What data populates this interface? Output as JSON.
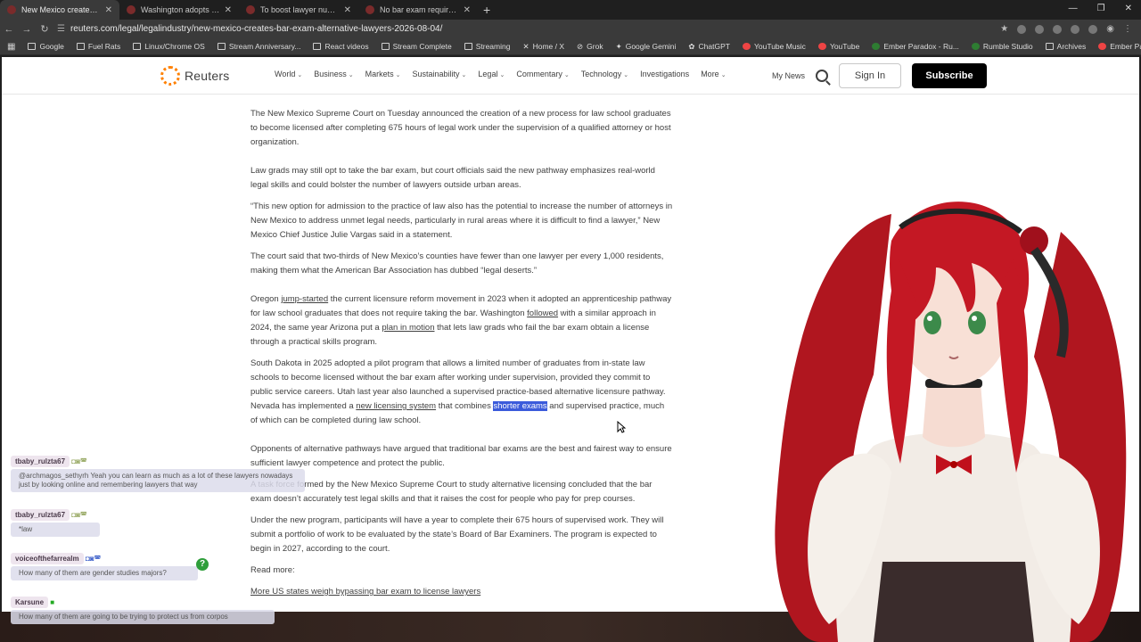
{
  "browser": {
    "tabs": [
      {
        "title": "New Mexico creates bar e",
        "active": true
      },
      {
        "title": "Washington adopts new lawye"
      },
      {
        "title": "To boost lawyer numbers in 'le"
      },
      {
        "title": "No bar exam required to prac"
      }
    ],
    "url": "reuters.com/legal/legalindustry/new-mexico-creates-bar-exam-alternative-lawyers-2026-08-04/",
    "bookmarks": [
      "Google",
      "Fuel Rats",
      "Linux/Chrome OS",
      "Stream Anniversary...",
      "React videos",
      "Stream Complete",
      "Streaming",
      "Home / X",
      "Grok",
      "Google Gemini",
      "ChatGPT",
      "YouTube Music",
      "YouTube",
      "Ember Paradox - Ru...",
      "Rumble Studio",
      "Archives",
      "Ember Paradox"
    ]
  },
  "site": {
    "logo_text": "Reuters",
    "nav": [
      "World",
      "Business",
      "Markets",
      "Sustainability",
      "Legal",
      "Commentary",
      "Technology",
      "Investigations",
      "More"
    ],
    "my_news": "My News",
    "sign_in": "Sign In",
    "subscribe": "Subscribe"
  },
  "article": {
    "p1": "The New Mexico Supreme Court on Tuesday announced the creation of a new process for law school graduates to become licensed after completing 675 hours of legal work under the supervision of a qualified attorney or host organization.",
    "p2": "Law grads may still opt to take the bar exam, but court officials said the new pathway emphasizes real-world legal skills and could bolster the number of lawyers outside urban areas.",
    "p3": "“This new option for admission to the practice of law also has the potential to increase the number of attorneys in New Mexico to address unmet legal needs, particularly in rural areas where it is difficult to find a lawyer,” New Mexico Chief Justice Julie Vargas said in a statement.",
    "p4": "The court said that two-thirds of New Mexico’s counties have fewer than one lawyer per every 1,000 residents, making them what the American Bar Association has dubbed “legal deserts.”",
    "p5": {
      "a": "Oregon ",
      "link1": "jump-started",
      "b": " the current licensure reform movement in 2023 when it adopted an apprenticeship pathway for law school graduates that does not require taking the bar. Washington ",
      "link2": "followed",
      "c": " with a similar approach in 2024, the same year Arizona put a ",
      "link3": "plan in motion",
      "d": " that lets law grads who fail the bar exam obtain a license through a practical skills program."
    },
    "p6": {
      "a": "South Dakota in 2025 adopted a pilot program that allows a limited number of graduates from in-state law schools to become licensed without the bar exam after working under supervision, provided they commit to public service careers. Utah last year also launched a supervised practice-based alternative licensure pathway. Nevada has implemented a ",
      "link1": "new licensing system",
      "b": " that combines ",
      "highlight": "shorter exams",
      "c": " and supervised practice, much of which can be completed during law school."
    },
    "p7": "Opponents of alternative pathways have argued that traditional bar exams are the best and fairest way to ensure sufficient lawyer competence and protect the public.",
    "p8": "A task force formed by the New Mexico Supreme Court to study alternative licensing concluded that the bar exam doesn’t accurately test legal skills and that it raises the cost for people who pay for prep courses.",
    "p9": "Under the new program, participants will have a year to complete their 675 hours of supervised work. They will submit a portfolio of work to be evaluated by the state’s Board of Bar Examiners. The program is expected to begin in 2027, according to the court.",
    "read_more": "Read more:",
    "read_more_link": "More US states weigh bypassing bar exam to license lawyers"
  },
  "chat": [
    {
      "user": "tbaby_rulzta67",
      "msg": "@archmagos_sethyrh Yeah you can learn as much as a lot of these lawyers nowadays just by looking online and remembering lawyers that way"
    },
    {
      "user": "tbaby_rulzta67",
      "msg": "*law"
    },
    {
      "user": "voiceofthefarrealm",
      "msg": "How many of them are gender studies majors?"
    },
    {
      "user": "Karsune",
      "msg": "How many of them are going to be trying to protect us from corpos"
    }
  ],
  "colors": {
    "accent": "#ff8000",
    "highlight": "#3b5bdb",
    "subscribe_bg": "#000000"
  }
}
